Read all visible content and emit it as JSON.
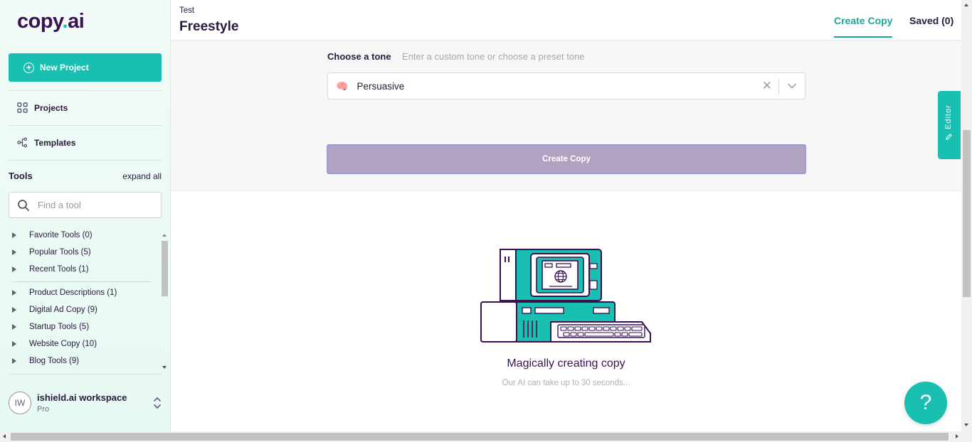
{
  "app": {
    "logo_main": "copy",
    "logo_dot": ".",
    "logo_end": "ai",
    "accent_color": "#19bfb0",
    "brand_color": "#3a1252"
  },
  "sidebar": {
    "new_project_label": "New Project",
    "nav": [
      {
        "label": "Projects",
        "icon": "grid-icon"
      },
      {
        "label": "Templates",
        "icon": "template-tree-icon"
      }
    ],
    "tools_title": "Tools",
    "expand_all_label": "expand all",
    "search_placeholder": "Find a tool",
    "tool_groups": [
      {
        "label": "Favorite Tools (0)"
      },
      {
        "label": "Popular Tools (5)"
      },
      {
        "label": "Recent Tools (1)"
      },
      {
        "label": "Product Descriptions (1)"
      },
      {
        "label": "Digital Ad Copy (9)"
      },
      {
        "label": "Startup Tools (5)"
      },
      {
        "label": "Website Copy (10)"
      },
      {
        "label": "Blog Tools (9)"
      }
    ],
    "workspace": {
      "initials": "IW",
      "name": "ishield.ai workspace",
      "plan": "Pro"
    }
  },
  "header": {
    "breadcrumb": "Test",
    "title": "Freestyle",
    "tabs": [
      {
        "label": "Create Copy",
        "active": true
      },
      {
        "label": "Saved (0)",
        "active": false
      }
    ]
  },
  "form": {
    "tone_label": "Choose a tone",
    "tone_hint": "Enter a custom tone or choose a preset tone",
    "tone_emoji": "🧠",
    "tone_value": "Persuasive",
    "create_button_label": "Create Copy"
  },
  "loading": {
    "title": "Magically creating copy",
    "subtitle": "Our AI can take up to 30 seconds..."
  },
  "widgets": {
    "editor_label": "Editor",
    "help_label": "?"
  }
}
